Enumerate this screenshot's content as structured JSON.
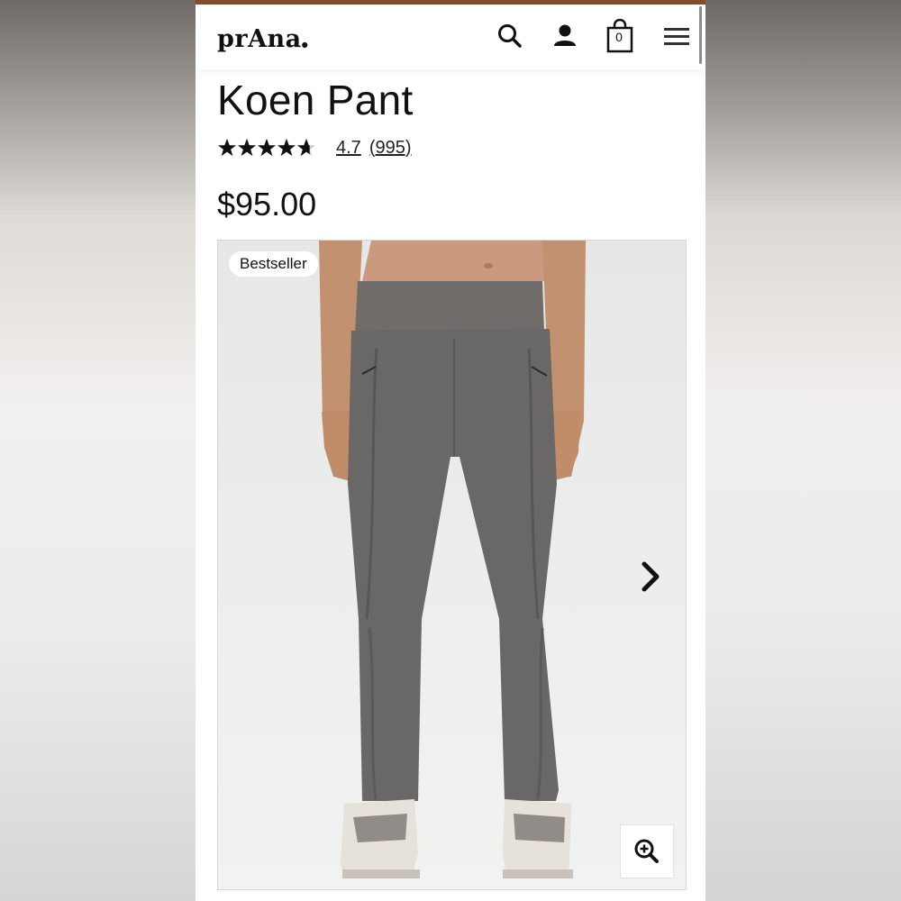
{
  "header": {
    "logo": "prAna",
    "bag_count": "0",
    "icons": [
      "search-icon",
      "account-icon",
      "shopping-bag-icon",
      "hamburger-menu-icon"
    ],
    "accent_color": "#8a4a2a"
  },
  "product": {
    "title": "Koen Pant",
    "rating_value": "4.7",
    "rating_count": "(995)",
    "stars": 4.7,
    "price": "$95.00",
    "badge": "Bestseller",
    "image": {
      "subject": "gray jogger pants on model",
      "icons": [
        "chevron-right-icon",
        "zoom-in-icon"
      ]
    }
  }
}
